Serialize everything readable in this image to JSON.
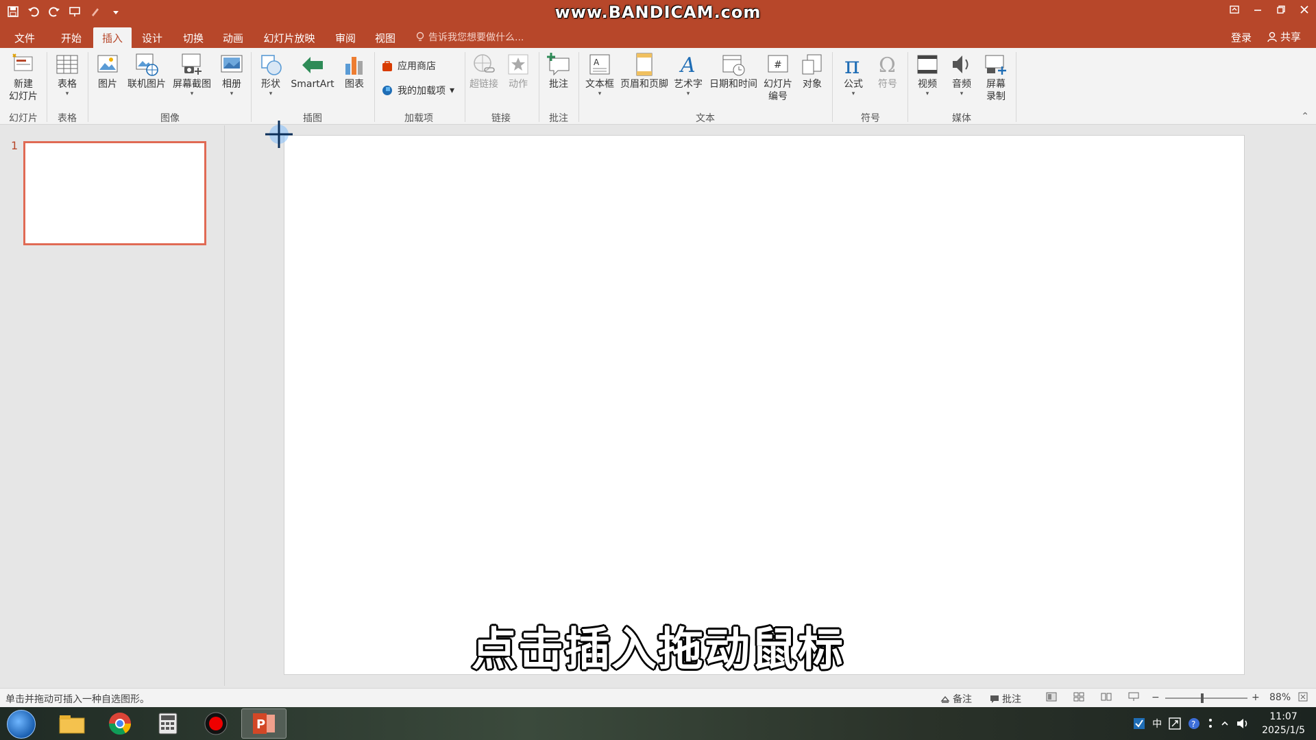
{
  "app": {
    "title": "www.BANDICAM.com",
    "colors": {
      "accent": "#b7472a",
      "ribbon_bg": "#f3f3f3",
      "workspace_bg": "#e6e6e6",
      "slide_border": "#e06a54"
    }
  },
  "quick_access": [
    "save-icon",
    "undo-icon",
    "redo-icon",
    "present-icon",
    "brush-icon",
    "customize-icon"
  ],
  "menu_tabs": {
    "file": "文件",
    "home": "开始",
    "insert": "插入",
    "design": "设计",
    "transitions": "切换",
    "animations": "动画",
    "slideshow": "幻灯片放映",
    "review": "审阅",
    "view": "视图"
  },
  "tell_me": "告诉我您想要做什么...",
  "account": {
    "login": "登录",
    "share": "共享"
  },
  "ribbon": {
    "new_slide": "新建\n幻灯片",
    "new_slide_l1": "新建",
    "new_slide_l2": "幻灯片",
    "table": "表格",
    "pictures": "图片",
    "online_pictures": "联机图片",
    "screenshot": "屏幕截图",
    "album": "相册",
    "shapes": "形状",
    "smartart": "SmartArt",
    "chart": "图表",
    "store": "应用商店",
    "my_addins": "我的加载项",
    "hyperlink": "超链接",
    "action": "动作",
    "comment": "批注",
    "textbox": "文本框",
    "header_footer": "页眉和页脚",
    "wordart": "艺术字",
    "date_time": "日期和时间",
    "slide_number_l1": "幻灯片",
    "slide_number_l2": "编号",
    "object": "对象",
    "equation": "公式",
    "symbol": "符号",
    "video": "视频",
    "audio": "音频",
    "screen_rec_l1": "屏幕",
    "screen_rec_l2": "录制",
    "groups": {
      "slides": "幻灯片",
      "tables": "表格",
      "images": "图像",
      "illustrations": "插图",
      "addins": "加载项",
      "links": "链接",
      "comments": "批注",
      "text": "文本",
      "symbols": "符号",
      "media": "媒体"
    }
  },
  "thumbnails": {
    "slide_number": "1"
  },
  "subtitle": "点击插入拖动鼠标",
  "status": {
    "hint": "单击并拖动可插入一种自选图形。",
    "notes": "备注",
    "comments": "批注",
    "zoom": "88%",
    "zoom_fraction": 0.45
  },
  "taskbar": {
    "apps": [
      "explorer-icon",
      "chrome-icon",
      "calculator-icon",
      "record-icon",
      "powerpoint-icon"
    ],
    "ime": "中",
    "time": "11:07",
    "date": "2025/1/5"
  }
}
